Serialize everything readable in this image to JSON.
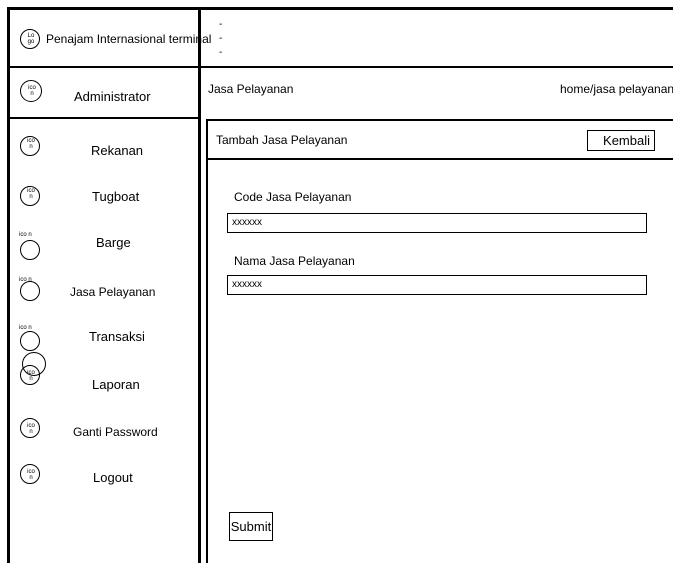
{
  "brand": {
    "logo_text": "Lo go",
    "title": "Penajam Internasional terminal"
  },
  "header": {
    "dashes": [
      "-",
      "-",
      "-"
    ]
  },
  "user": {
    "icon_text": "ico n",
    "name": "Administrator"
  },
  "sidebar": {
    "items": [
      {
        "icon_text": "ico n",
        "label": "Rekanan"
      },
      {
        "icon_text": "ico n",
        "label": "Tugboat"
      },
      {
        "icon_text": "ico n",
        "label": "Barge"
      },
      {
        "icon_text": "ico n",
        "label": "Jasa Pelayanan"
      },
      {
        "icon_text": "ico n",
        "label": "Transaksi"
      },
      {
        "icon_text": "ico n",
        "label": "Laporan"
      },
      {
        "icon_text": "ico n",
        "label": "Ganti Password"
      },
      {
        "icon_text": "ico n",
        "label": "Logout"
      }
    ]
  },
  "page": {
    "title": "Jasa Pelayanan",
    "breadcrumb": "home/jasa pelayanan"
  },
  "panel": {
    "title": "Tambah Jasa Pelayanan",
    "back_label": "Kembali"
  },
  "form": {
    "code_label": "Code Jasa Pelayanan",
    "code_value": "xxxxxx",
    "name_label": "Nama Jasa Pelayanan",
    "name_value": "xxxxxx",
    "submit_label": "Submit"
  }
}
